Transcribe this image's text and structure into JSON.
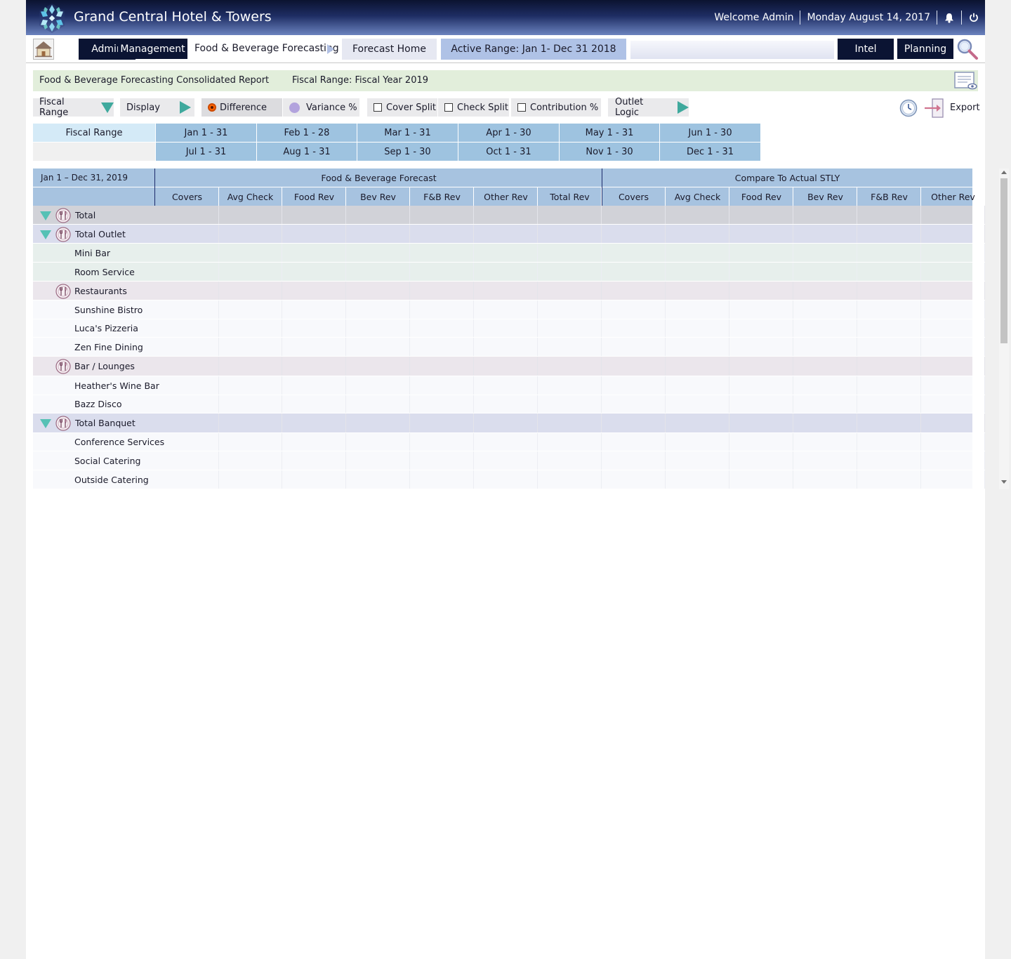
{
  "header": {
    "app_title": "Grand Central Hotel & Towers",
    "welcome": "Welcome Admin",
    "date": "Monday August 14, 2017",
    "gradient_colors": [
      "#0b1330",
      "#1e2d63",
      "#6b83bf"
    ]
  },
  "nav": {
    "admin": "Admin",
    "management": "Management",
    "breadcrumb_current": "Food & Beverage Forecasting",
    "forecast_home": "Forecast Home",
    "active_range": "Active Range: Jan 1- Dec 31 2018",
    "intel": "Intel",
    "planning": "Planning"
  },
  "report": {
    "title": "Food & Beverage Forecasting Consolidated Report",
    "fiscal_range": "Fiscal Range: Fiscal Year 2019"
  },
  "toolbar": {
    "fiscal_range": "Fiscal Range",
    "display": "Display",
    "difference": "Difference",
    "variance": "Variance %",
    "cover_split": "Cover Split",
    "check_split": "Check Split",
    "contribution": "Contribution %",
    "outlet_logic": "Outlet Logic",
    "export": "Export",
    "selected_display": "Difference"
  },
  "months": {
    "label": "Fiscal Range",
    "row1": [
      "Jan 1 - 31",
      "Feb 1 - 28",
      "Mar 1 - 31",
      "Apr 1 - 30",
      "May 1 - 31",
      "Jun 1 - 30"
    ],
    "row2": [
      "Jul 1 - 31",
      "Aug 1 - 31",
      "Sep 1 - 30",
      "Oct 1 - 31",
      "Nov 1 - 30",
      "Dec 1 - 31"
    ]
  },
  "table": {
    "date_range": "Jan 1 – Dec 31, 2019",
    "group_forecast": "Food & Beverage Forecast",
    "group_compare": "Compare To Actual STLY",
    "forecast_columns": [
      "Covers",
      "Avg Check",
      "Food Rev",
      "Bev Rev",
      "F&B Rev",
      "Other Rev",
      "Total Rev"
    ],
    "compare_columns": [
      "Covers",
      "Avg Check",
      "Food Rev",
      "Bev Rev",
      "F&B Rev",
      "Other Rev"
    ],
    "rows": [
      {
        "label": "Total",
        "level": "total"
      },
      {
        "label": "Total Outlet",
        "level": "section"
      },
      {
        "label": "Mini Bar",
        "level": "child-green"
      },
      {
        "label": "Room Service",
        "level": "child-green"
      },
      {
        "label": "Restaurants",
        "level": "group"
      },
      {
        "label": "Sunshine Bistro",
        "level": "child"
      },
      {
        "label": "Luca's Pizzeria",
        "level": "child"
      },
      {
        "label": "Zen Fine Dining",
        "level": "child"
      },
      {
        "label": "Bar / Lounges",
        "level": "group"
      },
      {
        "label": "Heather's Wine Bar",
        "level": "child"
      },
      {
        "label": "Bazz Disco",
        "level": "child"
      },
      {
        "label": "Total Banquet",
        "level": "section"
      },
      {
        "label": "Conference Services",
        "level": "child"
      },
      {
        "label": "Social Catering",
        "level": "child"
      },
      {
        "label": "Outside Catering",
        "level": "child"
      }
    ]
  },
  "icons": {
    "logo": "snowflake-logo-icon",
    "bell": "bell-icon",
    "power": "power-icon",
    "home": "home-icon",
    "search": "magnifier-icon",
    "report": "report-view-icon",
    "clock": "clock-icon",
    "export": "export-icon",
    "row": "utensils-icon"
  }
}
